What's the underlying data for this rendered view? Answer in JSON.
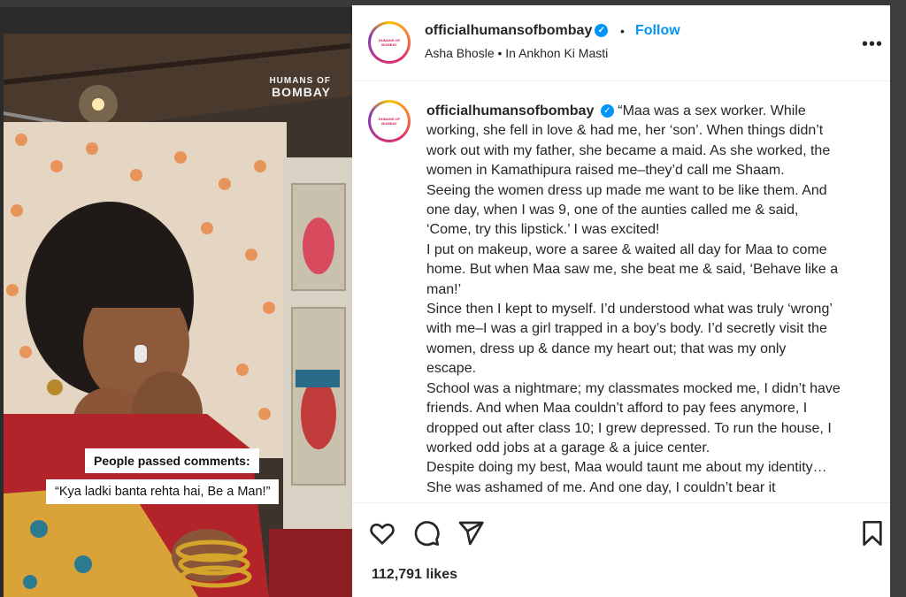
{
  "post": {
    "username": "officialhumansofbombay",
    "separator": "•",
    "follow_label": "Follow",
    "audio": "Asha Bhosle • In Ankhon Ki Masti",
    "more_label": "•••",
    "caption_lines": [
      "“Maa was a sex worker. While",
      "working, she fell in love & had me, her ‘son’. When things didn’t",
      "work out with my father, she became a maid. As she worked, the",
      "women in Kamathipura raised me–they’d call me Shaam.",
      "Seeing the women dress up made me want to be like them. And",
      "one day, when I was 9, one of the aunties called me & said,",
      "‘Come, try this lipstick.’ I was excited!",
      "I put on makeup, wore a saree & waited all day for Maa to come",
      "home. But when Maa saw me, she beat me & said, ‘Behave like a",
      "man!’",
      "Since then I kept to myself. I’d understood what was truly ‘wrong’",
      "with me–I was a girl trapped in a boy’s body. I’d secretly visit the",
      "women, dress up & dance my heart out; that was my only",
      "escape.",
      "School was a nightmare; my classmates mocked me, I didn’t have",
      "friends. And when Maa couldn’t afford to pay fees anymore, I",
      "dropped out after class 10; I grew depressed. To run the house, I",
      "worked odd jobs at a garage & a juice center.",
      "Despite doing my best, Maa would taunt me about my identity…",
      "She was ashamed of me. And one day, I couldn’t bear it"
    ],
    "likes": "112,791 likes"
  },
  "media": {
    "watermark_line1": "HUMANS OF",
    "watermark_line2": "BOMBAY",
    "caption1": "People passed comments:",
    "caption2": "“Kya ladki banta rehta hai, Be a Man!”"
  },
  "avatar_text": [
    "HUMANS OF",
    "BOMBAY"
  ],
  "icons": [
    "heart-icon",
    "comment-icon",
    "share-icon",
    "bookmark-icon",
    "verified-icon",
    "more-icon"
  ],
  "colors": {
    "follow": "#0095f6",
    "verified": "#0095f6",
    "text": "#262626"
  }
}
